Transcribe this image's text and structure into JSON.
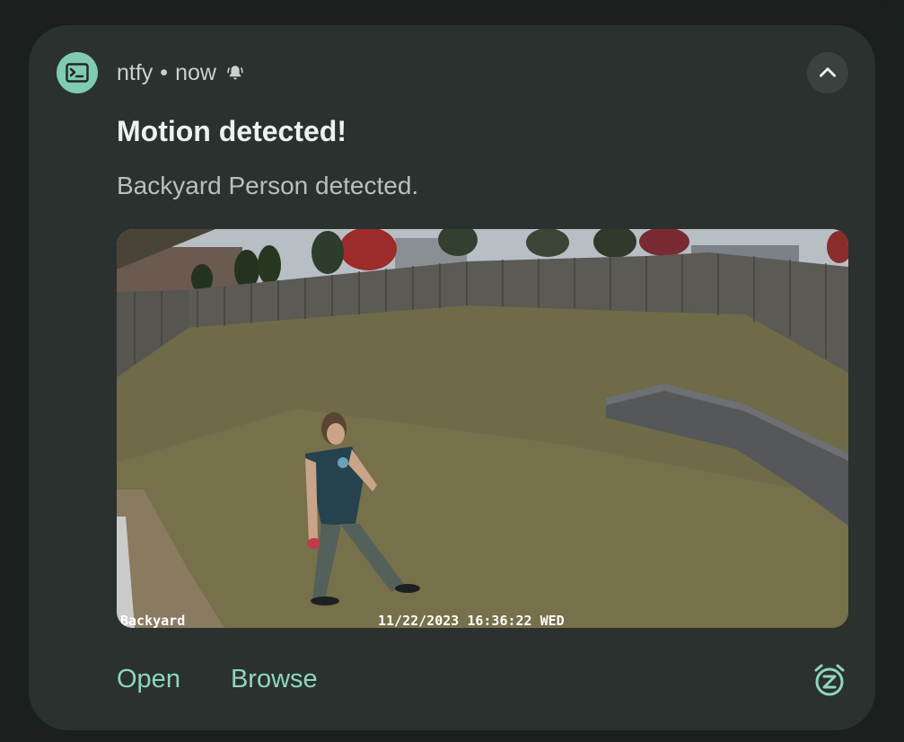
{
  "notification": {
    "app_name": "ntfy",
    "separator": "•",
    "time": "now",
    "title": "Motion detected!",
    "message": "Backyard Person detected.",
    "attachment": {
      "camera_label": "Backyard",
      "timestamp": "11/22/2023 16:36:22 WED"
    },
    "actions": [
      {
        "label": "Open"
      },
      {
        "label": "Browse"
      }
    ],
    "icons": {
      "app": "terminal-icon",
      "priority": "bell-alert-icon",
      "collapse": "chevron-up-icon",
      "snooze": "snooze-alarm-icon"
    },
    "colors": {
      "accent": "#8fd6bf",
      "app_icon_bg": "#80cbb3",
      "card_bg": "#2a312e"
    }
  }
}
